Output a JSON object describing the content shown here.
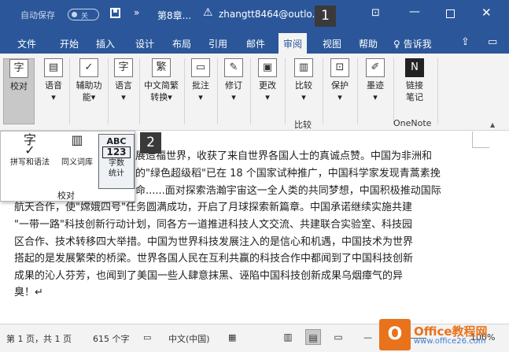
{
  "titlebar": {
    "autosave_label": "自动保存",
    "autosave_state": "关",
    "doc_title": "第8章...",
    "user": "zhangtt8464@outlo...m",
    "icons": [
      "save-icon",
      "more-icon",
      "warning-icon",
      "restore-icon",
      "minimize-icon",
      "maximize-icon",
      "close-icon"
    ]
  },
  "callouts": {
    "one": "1",
    "two": "2"
  },
  "tabs": {
    "items": [
      "文件",
      "开始",
      "插入",
      "设计",
      "布局",
      "引用",
      "邮件",
      "审阅",
      "视图",
      "帮助"
    ],
    "active": "审阅",
    "tell_me": "告诉我"
  },
  "ribbon": {
    "buttons": {
      "proofing": "校对",
      "language": "语音",
      "accessibility_1": "辅助功",
      "accessibility_2": "能",
      "lang": "语言",
      "chinese_conv_1": "中文简繁",
      "chinese_conv_2": "转换",
      "comments": "批注",
      "tracking": "修订",
      "changes": "更改",
      "compare": "比较",
      "protect": "保护",
      "ink": "墨迹",
      "linked_notes_1": "链接",
      "linked_notes_2": "笔记"
    },
    "group_labels": {
      "compare": "比较",
      "onenote": "OneNote"
    }
  },
  "dropdown": {
    "spelling": "拼写和语法",
    "thesaurus": "同义词库",
    "word_count_abc": "ABC",
    "word_count_num": "123",
    "word_count_1": "字数",
    "word_count_2": "统计",
    "group_label": "校对"
  },
  "document": {
    "lines": [
      "展造福世界，收获了来自世界各国人士的真诚点赞。中国为非洲和",
      "的\"绿色超级稻\"已在 18 个国家试种推广，中国科学家发现青蒿素挽",
      "命......面对探索浩瀚宇宙这一全人类的共同梦想，中国积极推动国际",
      "航天合作，使\"嫦娥四号\"任务圆满成功，开启了月球探索新篇章。中国承诺继续实施共建",
      "\"一带一路\"科技创新行动计划，同各方一道推进科技人文交流、共建联合实验室、科技园",
      "区合作、技术转移四大举措。中国为世界科技发展注入的是信心和机遇，中国技术为世界",
      "搭起的是发展繁荣的桥梁。世界各国人民在互利共赢的科技合作中都闻到了中国科技创新",
      "成果的沁人芬芳，也闻到了美国一些人肆意抹黑、诬陷中国科技创新成果乌烟瘴气的异",
      "臭！↵"
    ]
  },
  "statusbar": {
    "page": "第 1 页，共 1 页",
    "words": "615 个字",
    "language": "中文(中国)",
    "zoom": "100%"
  },
  "watermark": {
    "logo": "O",
    "text": "Office教程网",
    "url": "www.office26.com"
  }
}
